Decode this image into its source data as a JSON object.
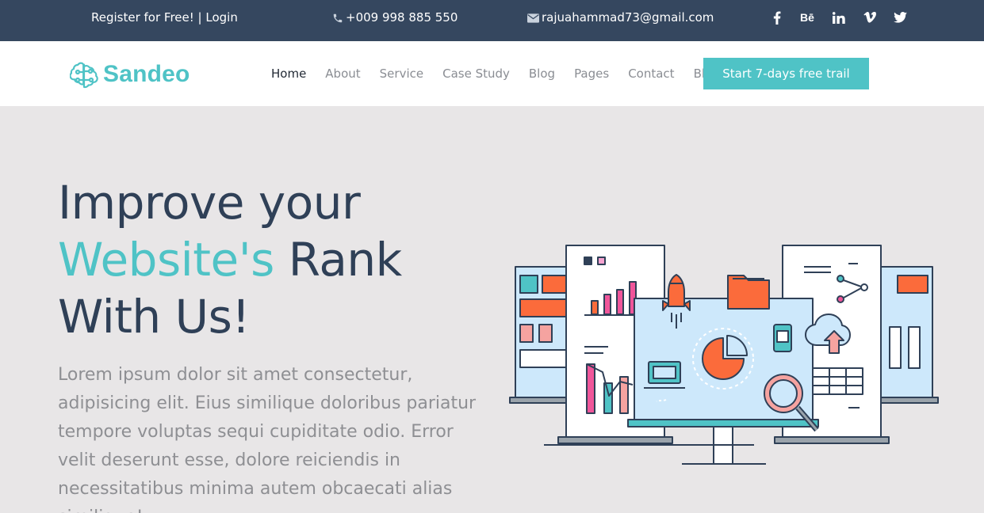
{
  "topbar": {
    "register": "Register for Free!",
    "separator": "|",
    "login": "Login",
    "phone": "+009 998 885 550",
    "email": "rajuahammad73@gmail.com",
    "socials": [
      {
        "name": "facebook-icon",
        "glyph": "f"
      },
      {
        "name": "behance-icon",
        "glyph": "Bē"
      },
      {
        "name": "linkedin-icon",
        "glyph": "in"
      },
      {
        "name": "vimeo-icon",
        "glyph": "v"
      },
      {
        "name": "twitter-icon",
        "glyph": "twitter"
      }
    ]
  },
  "nav": {
    "logo_text": "Sandeo",
    "items": [
      "Home",
      "About",
      "Service",
      "Case Study",
      "Blog",
      "Pages",
      "Contact",
      "Blog"
    ],
    "active": "Home",
    "cta": "Start 7-days free trail"
  },
  "hero": {
    "title_line1": "Improve your",
    "title_accent": "Website's",
    "title_line2_rest": " Rank",
    "title_line3": "With Us!",
    "description": "Lorem ipsum dolor sit amet consectetur, adipisicing elit. Eius similique doloribus pariatur tempore voluptas sequi cupiditate odio. Error velit deserunt esse, dolore reiciendis in necessitatibus minima autem obcaecati alias similique!"
  },
  "colors": {
    "topbar_bg": "#35475f",
    "accent": "#4fc3c6",
    "hero_bg": "#e8e6e7",
    "orange": "#fb6b3b",
    "pink": "#f0569a",
    "navy": "#2f4057",
    "light_blue": "#cde8fb"
  }
}
